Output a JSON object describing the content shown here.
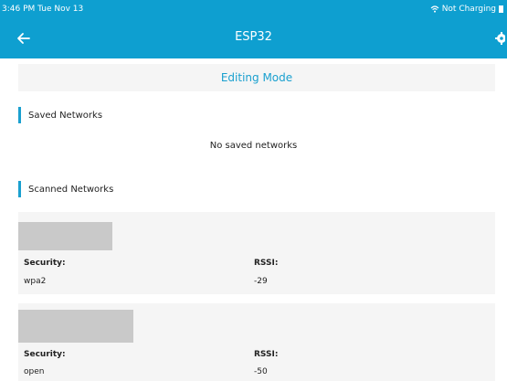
{
  "status_bar": {
    "time": "3:46 PM  Tue Nov 13",
    "charging": "Not Charging"
  },
  "nav": {
    "title": "ESP32",
    "back_icon": "back-arrow-icon",
    "settings_icon": "gear-icon"
  },
  "banner": {
    "text": "Editing Mode"
  },
  "saved_networks": {
    "label": "Saved Networks",
    "empty_text": "No saved networks"
  },
  "scanned_networks": {
    "label": "Scanned Networks",
    "items": [
      {
        "security_label": "Security:",
        "security": "wpa2",
        "rssi_label": "RSSI:",
        "rssi": "-29"
      },
      {
        "security_label": "Security:",
        "security": "open",
        "rssi_label": "RSSI:",
        "rssi": "-50"
      }
    ]
  },
  "colors": {
    "header": "#0e9fd0",
    "accent": "#1aa0cf",
    "card": "#f5f5f5"
  }
}
